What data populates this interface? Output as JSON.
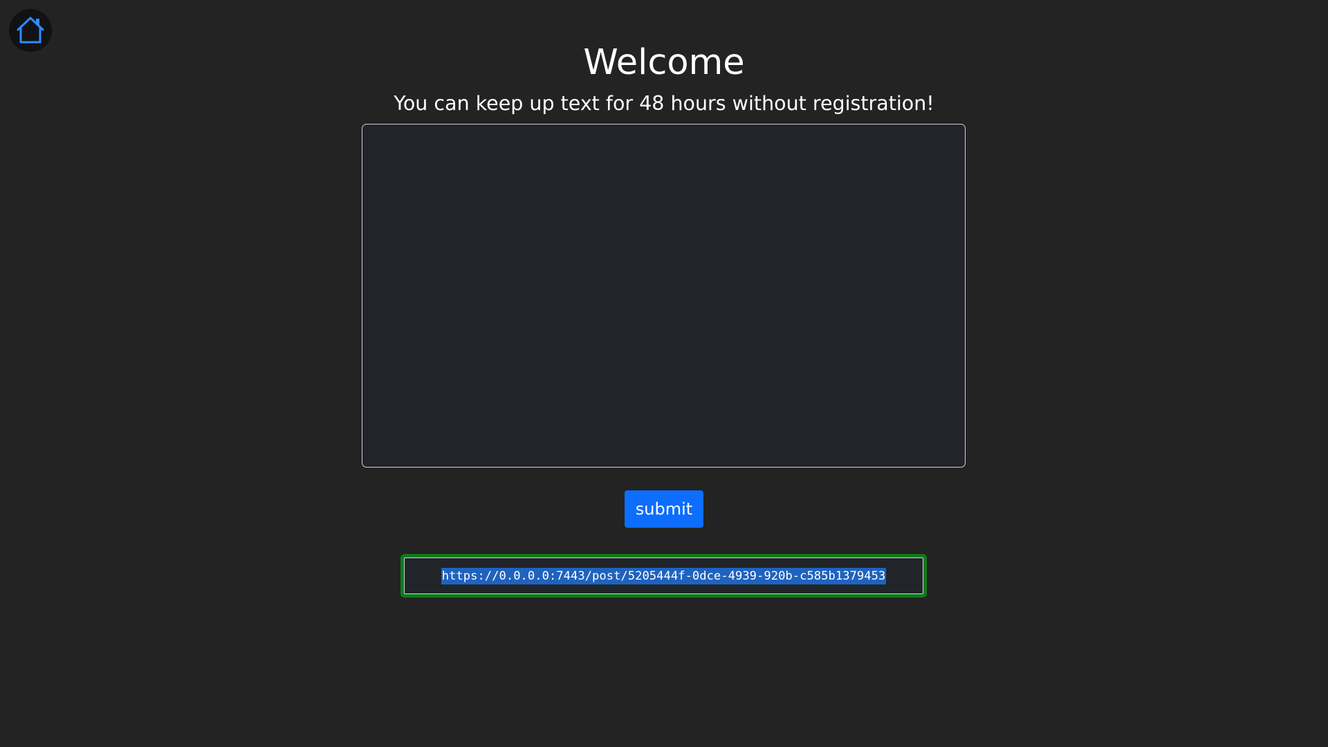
{
  "nav": {
    "home_icon": "home-icon",
    "accent_color": "#2f8cff"
  },
  "header": {
    "title": "Welcome",
    "subtitle": "You can keep up text for 48 hours without registration!"
  },
  "editor": {
    "value": "",
    "placeholder": ""
  },
  "actions": {
    "submit_label": "submit",
    "submit_color": "#0d6efd"
  },
  "result": {
    "url": "https://0.0.0.0:7443/post/5205444f-0dce-4939-920b-c585b1379453",
    "border_color": "#0c7d19",
    "selection_color": "#1f63bf"
  }
}
